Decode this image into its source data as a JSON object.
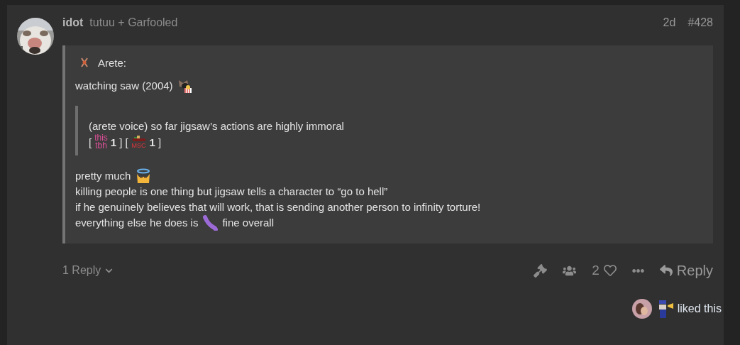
{
  "post": {
    "author": "idot",
    "groups": "tutuu + Garfooled",
    "age": "2d",
    "number": "#428",
    "quote": {
      "author": "Arete:",
      "first_line": "watching saw (2004)",
      "inner_quote": {
        "text": "(arete voice) so far jigsaw’s actions are highly immoral",
        "open": "[",
        "close": "]",
        "reactions": [
          {
            "kind": "text-emoji",
            "lines": [
              "this",
              "tbh"
            ],
            "count": "1"
          },
          {
            "kind": "image-emoji",
            "caption": "MSC",
            "count": "1"
          }
        ]
      },
      "lines": [
        {
          "kind": "halo-cat",
          "text": "pretty much"
        },
        {
          "kind": "plain",
          "text": "killing people is one thing but jigsaw tells a character to “go to hell”"
        },
        {
          "kind": "plain",
          "text": "if he genuinely believes that will work, that is sending another person to infinity torture!"
        },
        {
          "kind": "worm",
          "text": "everything else he does is",
          "after": "fine overall"
        }
      ]
    },
    "replies": "1 Reply",
    "likes": "2",
    "reply_button": "Reply",
    "liked_text": "liked this"
  }
}
